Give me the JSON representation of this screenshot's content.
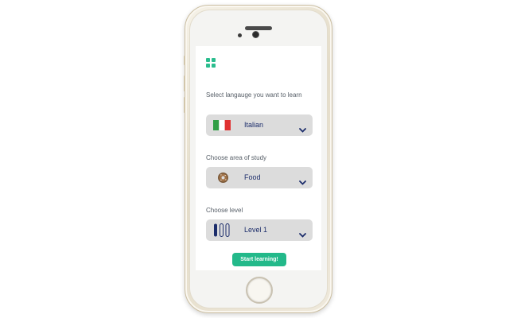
{
  "app": {
    "menu_icon": "grid-menu-icon"
  },
  "language": {
    "label": "Select langauge you want to learn",
    "value": "Italian",
    "icon": "italy-flag-icon",
    "flag_colors": [
      "#2f9e44",
      "#ffffff",
      "#e03131"
    ]
  },
  "area": {
    "label": "Choose area of study",
    "value": "Food",
    "icon": "donut-icon"
  },
  "level": {
    "label": "Choose level",
    "value": "Level 1",
    "icon": "level-bars-icon"
  },
  "actions": {
    "start_label": "Start learning!"
  },
  "colors": {
    "accent": "#23b98a",
    "select_text": "#1c2d6b",
    "select_bg": "#dcdcdc"
  }
}
